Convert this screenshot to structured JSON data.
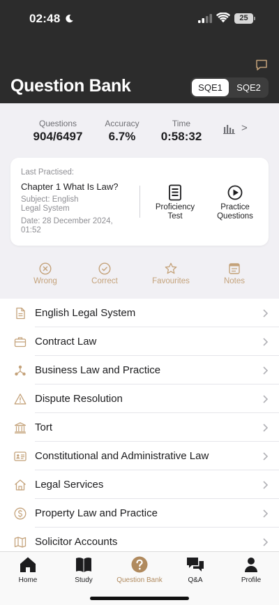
{
  "status_bar": {
    "time": "02:48",
    "battery": "25"
  },
  "header": {
    "title": "Question Bank",
    "segments": [
      {
        "label": "SQE1",
        "selected": true
      },
      {
        "label": "SQE2",
        "selected": false
      }
    ]
  },
  "stats": {
    "questions_label": "Questions",
    "questions_value": "904/6497",
    "accuracy_label": "Accuracy",
    "accuracy_value": "6.7%",
    "time_label": "Time",
    "time_value": "0:58:32",
    "more_arrow": ">"
  },
  "last_practised": {
    "label": "Last Practised:",
    "chapter": "Chapter 1 What Is Law?",
    "subject": "Subject: English Legal System",
    "date": "Date: 28 December 2024, 01:52",
    "proficiency_label": "Proficiency Test",
    "practice_label": "Practice Questions"
  },
  "quick_links": {
    "wrong": "Wrong",
    "correct": "Correct",
    "favourites": "Favourites",
    "notes": "Notes"
  },
  "subjects": [
    {
      "label": "English Legal System",
      "icon": "document-icon"
    },
    {
      "label": "Contract Law",
      "icon": "briefcase-icon"
    },
    {
      "label": "Business Law and Practice",
      "icon": "network-icon"
    },
    {
      "label": "Dispute Resolution",
      "icon": "warning-icon"
    },
    {
      "label": "Tort",
      "icon": "courthouse-icon"
    },
    {
      "label": "Constitutional and Administrative Law",
      "icon": "id-card-icon"
    },
    {
      "label": "Legal Services",
      "icon": "house-icon"
    },
    {
      "label": "Property Law and Practice",
      "icon": "dollar-coin-icon"
    },
    {
      "label": "Solicitor Accounts",
      "icon": "map-icon"
    }
  ],
  "tabs": [
    {
      "label": "Home",
      "icon": "house-icon"
    },
    {
      "label": "Study",
      "icon": "book-icon"
    },
    {
      "label": "Question Bank",
      "icon": "question-circle-icon",
      "active": true
    },
    {
      "label": "Q&A",
      "icon": "chat-bubbles-icon"
    },
    {
      "label": "Profile",
      "icon": "person-icon"
    }
  ],
  "colors": {
    "accent": "#c4a27a",
    "header_bg": "#2c2c2c",
    "active_tab": "#b08a5e"
  }
}
